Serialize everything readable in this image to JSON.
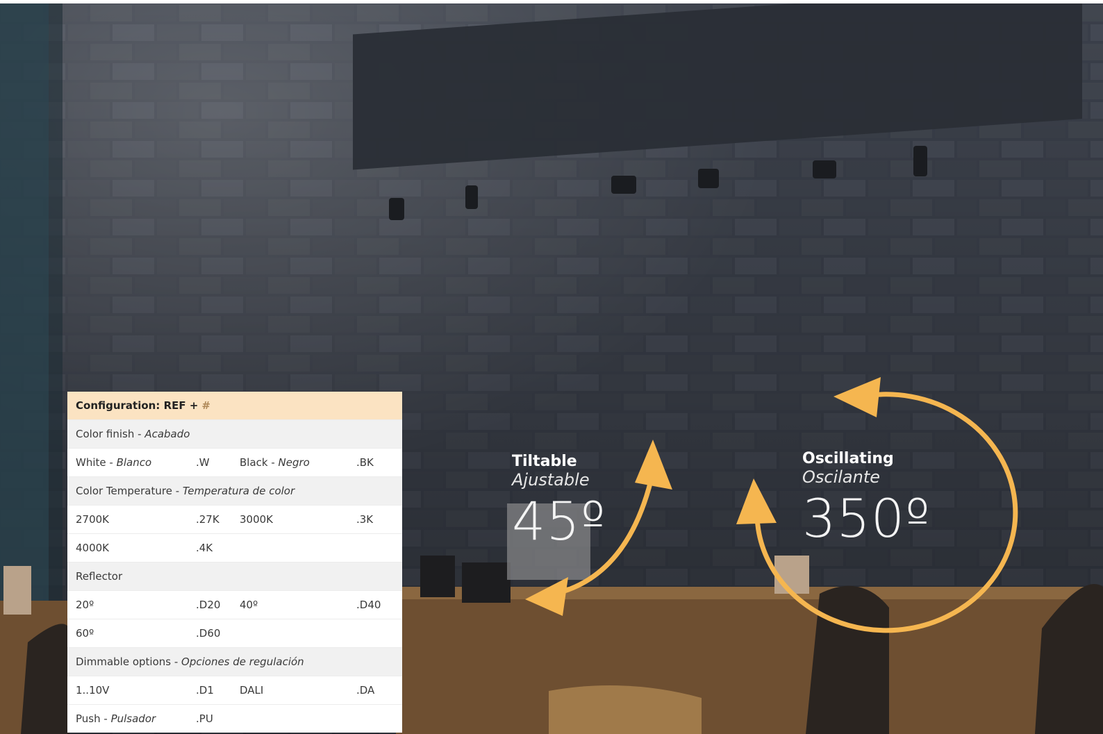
{
  "config": {
    "title": "Configuration: REF +",
    "hash": "#",
    "sections": [
      {
        "name": "Color finish",
        "name_es": "Acabado",
        "rows": [
          [
            {
              "label": "White",
              "label_es": "Blanco",
              "code": ".W"
            },
            {
              "label": "Black",
              "label_es": "Negro",
              "code": ".BK"
            }
          ]
        ]
      },
      {
        "name": "Color Temperature",
        "name_es": "Temperatura de color",
        "rows": [
          [
            {
              "label": "2700K",
              "code": ".27K"
            },
            {
              "label": "3000K",
              "code": ".3K"
            }
          ],
          [
            {
              "label": "4000K",
              "code": ".4K"
            }
          ]
        ]
      },
      {
        "name": "Reflector",
        "rows": [
          [
            {
              "label": "20º",
              "code": ".D20"
            },
            {
              "label": "40º",
              "code": ".D40"
            }
          ],
          [
            {
              "label": "60º",
              "code": ".D60"
            }
          ]
        ]
      },
      {
        "name": "Dimmable options",
        "name_es": "Opciones de regulación",
        "rows": [
          [
            {
              "label": "1..10V",
              "code": ".D1"
            },
            {
              "label": "DALI",
              "code": ".DA"
            }
          ],
          [
            {
              "label": "Push",
              "label_es": "Pulsador",
              "code": ".PU"
            }
          ]
        ]
      }
    ]
  },
  "tiltable": {
    "title": "Tiltable",
    "subtitle": "Ajustable",
    "angle": "45º"
  },
  "oscillating": {
    "title": "Oscillating",
    "subtitle": "Oscilante",
    "angle": "350º"
  },
  "colors": {
    "accent": "#f5b650",
    "wall": "#2f3440",
    "header_bg": "#fbe3c2"
  }
}
